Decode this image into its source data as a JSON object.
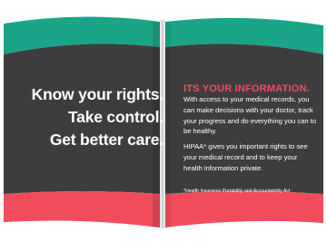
{
  "left_panel": {
    "headline_lines": [
      "Know your rights.",
      "Take control.",
      "Get better care."
    ]
  },
  "right_panel": {
    "heading": "ITS YOUR INFORMATION.",
    "paragraph1": "With access to your medical records, you can make decisions with your doctor, track your progress and do everything you can to be healthy.",
    "paragraph2": "HIPAA* gives you important rights to see your medical record and to keep your health information private.",
    "footnote": "*Health Insurance Portability and Accountability Act"
  },
  "colors": {
    "teal": "#1aa488",
    "dark": "#3d3d40",
    "coral": "#f04c5c",
    "white": "#ffffff"
  }
}
